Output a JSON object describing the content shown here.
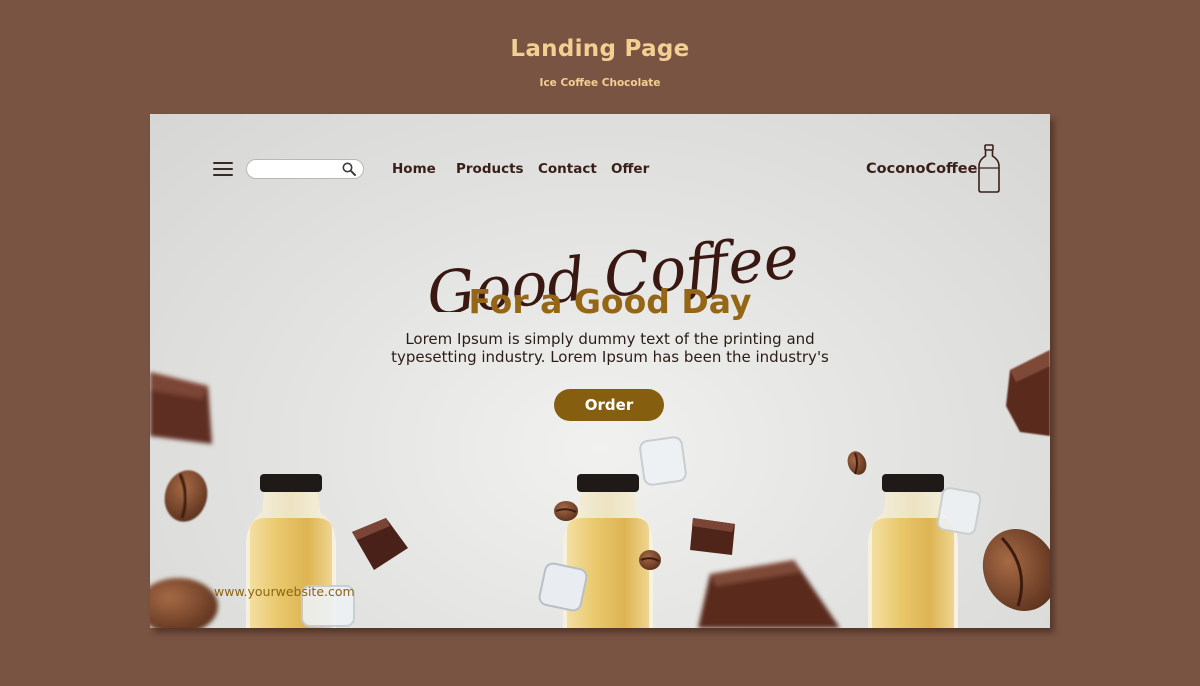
{
  "presentation": {
    "title": "Landing Page",
    "subtitle": "Ice Coffee Chocolate"
  },
  "header": {
    "menu_icon": "hamburger-icon",
    "search": {
      "placeholder": "",
      "value": "",
      "icon": "search-icon"
    },
    "nav": [
      "Home",
      "Products",
      "Contact",
      "Offer"
    ],
    "brand": "CoconoCoffee",
    "brand_icon": "bottle-icon"
  },
  "hero": {
    "script_title": "Good Coffee",
    "title": "For a Good Day",
    "description_line1": "Lorem Ipsum is simply dummy text of the printing and",
    "description_line2": "typesetting industry. Lorem Ipsum has been the industry's",
    "cta": "Order"
  },
  "footer": {
    "website": "www.yourwebsite.com"
  },
  "colors": {
    "background": "#7a5443",
    "accent_gold": "#946615",
    "button": "#855e0f",
    "title_cream": "#f3cf92",
    "dark_text": "#3a1f18",
    "milk": "#e6c46a"
  }
}
